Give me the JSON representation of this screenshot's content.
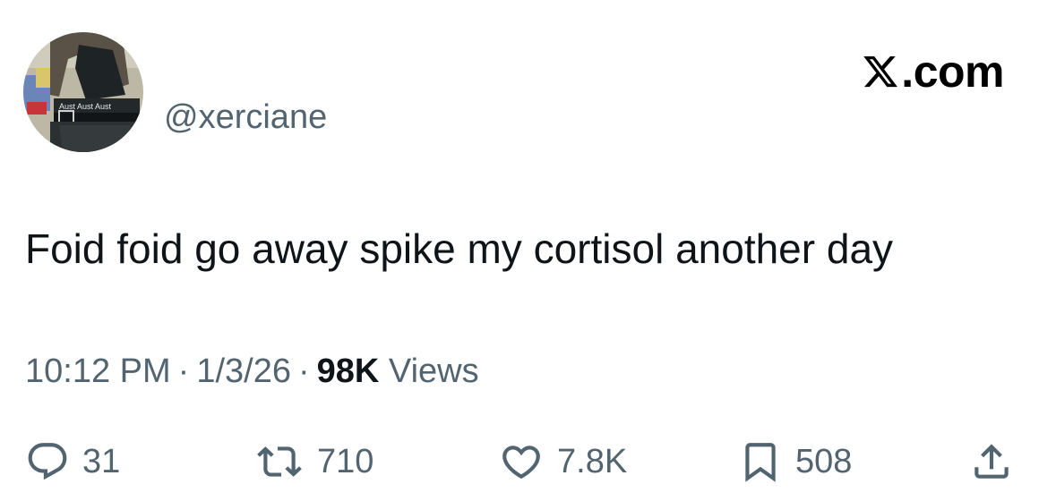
{
  "author": {
    "handle": "@xerciane",
    "avatar_icon": "profile-photo",
    "avatar_text": "Aust Aust Aust"
  },
  "brand": {
    "icon": "x-logo-icon",
    "domain": ".com"
  },
  "tweet": {
    "text": "Foid foid go away spike my cortisol another day"
  },
  "meta": {
    "time": "10:12 PM",
    "separator": "·",
    "date": "1/3/26",
    "views_count": "98K",
    "views_label": "Views"
  },
  "actions": {
    "replies": "31",
    "reposts": "710",
    "likes": "7.8K",
    "bookmarks": "508"
  },
  "colors": {
    "text_primary": "#0f1419",
    "text_secondary": "#536471",
    "icon": "#536471",
    "background": "#ffffff"
  }
}
